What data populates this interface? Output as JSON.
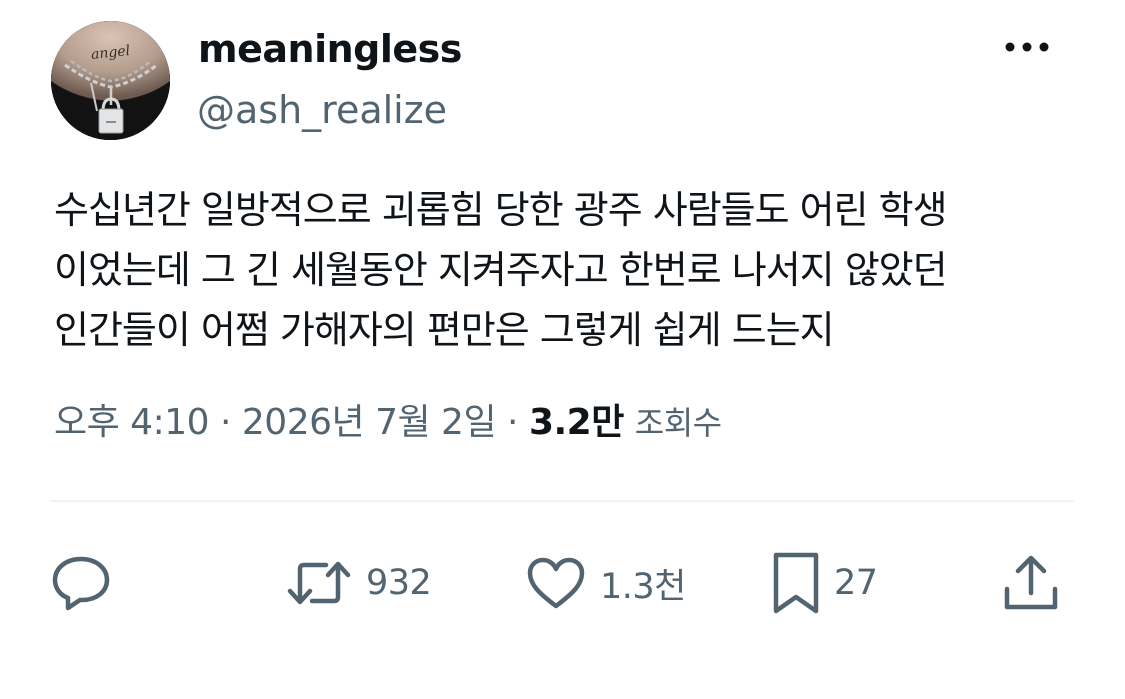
{
  "user": {
    "display_name": "meaningless",
    "handle": "@ash_realize",
    "avatar_icon": "chain-padlock-necklace-photo",
    "avatar_text": "angel"
  },
  "tweet": {
    "lines": [
      "수십년간 일방적으로 괴롭힘 당한 광주 사람들도 어린 학생",
      "이었는데 그 긴 세월동안 지켜주자고 한번로 나서지 않았던",
      "인간들이 어쩜 가해자의 편만은 그렇게 쉽게 드는지"
    ]
  },
  "meta": {
    "time": "오후 4:10",
    "separator": "·",
    "date": "2026년 7월 2일",
    "views_count": "3.2만",
    "views_label": "조회수"
  },
  "actions": {
    "reply": {
      "icon": "reply-icon",
      "count": ""
    },
    "retweet": {
      "icon": "retweet-icon",
      "count": "932"
    },
    "like": {
      "icon": "heart-icon",
      "count": "1.3천"
    },
    "bookmark": {
      "icon": "bookmark-icon",
      "count": "27"
    },
    "share": {
      "icon": "share-icon",
      "count": ""
    }
  },
  "colors": {
    "text_primary": "#0f1419",
    "text_secondary": "#536471",
    "divider": "#eff3f4"
  }
}
